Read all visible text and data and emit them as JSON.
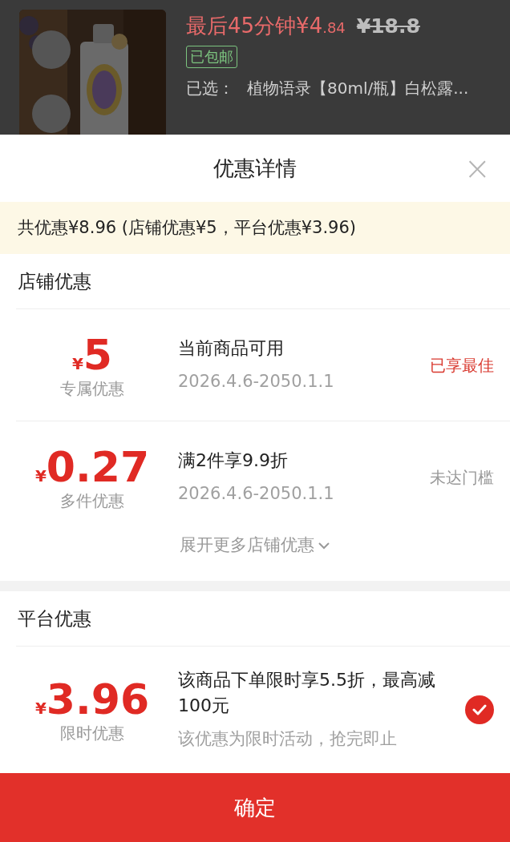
{
  "product": {
    "kind": "picture",
    "price_main": "最后45分钟¥4",
    "price_decimals": ".84",
    "original_price": "¥18.8",
    "shipping_badge": "已包邮",
    "selected_label": "已选：",
    "selected_value": "植物语录【80ml/瓶】白松露..."
  },
  "sheet": {
    "title": "优惠详情",
    "close": "×",
    "summary": "共优惠¥8.96 (店铺优惠¥5，平台优惠¥3.96)",
    "sections": [
      {
        "title": "店铺优惠",
        "coupons": [
          {
            "currency": "¥",
            "amount": "5",
            "label": "专属优惠",
            "title": "当前商品可用",
            "detail": "2026.4.6-2050.1.1",
            "kind": "status",
            "status": "已享最佳",
            "highlight": true
          },
          {
            "currency": "¥",
            "amount": "0.27",
            "label": "多件优惠",
            "title": "满2件享9.9折",
            "detail": "2026.4.6-2050.1.1",
            "kind": "status",
            "status": "未达门槛",
            "highlight": false
          }
        ],
        "more": "展开更多店铺优惠"
      },
      {
        "title": "平台优惠",
        "coupons": [
          {
            "currency": "¥",
            "amount": "3.96",
            "label": "限时优惠",
            "title": "该商品下单限时享5.5折，最高减100元",
            "detail": "该优惠为限时活动，抢完即止",
            "kind": "check",
            "checked": true
          }
        ]
      }
    ],
    "confirm": "确定"
  }
}
